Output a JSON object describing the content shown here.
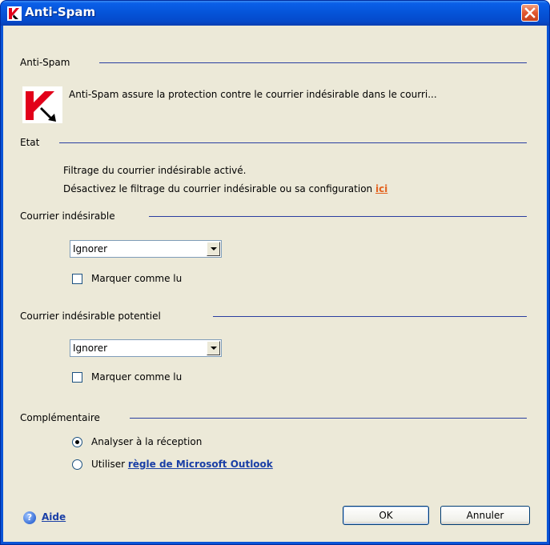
{
  "window": {
    "title": "Anti-Spam"
  },
  "sections": {
    "antispam": {
      "label": "Anti-Spam",
      "description": "Anti-Spam assure la protection contre le courrier indésirable dans le courri..."
    },
    "etat": {
      "label": "Etat",
      "line1": "Filtrage du courrier indésirable activé.",
      "line2": "Désactivez le filtrage du courrier indésirable ou sa configuration ",
      "link": "ici"
    },
    "spam": {
      "label": "Courrier indésirable",
      "action": "Ignorer",
      "mark_read_label": "Marquer comme lu",
      "mark_read_checked": false
    },
    "potential": {
      "label": "Courrier indésirable potentiel",
      "action": "Ignorer",
      "mark_read_label": "Marquer comme lu",
      "mark_read_checked": false
    },
    "extra": {
      "label": "Complémentaire",
      "option1": "Analyser à la réception",
      "option2_prefix": "Utiliser ",
      "option2_link": "règle de Microsoft Outlook",
      "selected": "option1"
    }
  },
  "footer": {
    "help_label": "Aide",
    "ok_label": "OK",
    "cancel_label": "Annuler"
  },
  "colors": {
    "titlebar": "#0553d8",
    "client_bg": "#ece9d8",
    "separator": "#2a3ea0",
    "link_orange": "#e3621e",
    "link_blue": "#1a3fa6",
    "close_button": "#e1562f"
  }
}
